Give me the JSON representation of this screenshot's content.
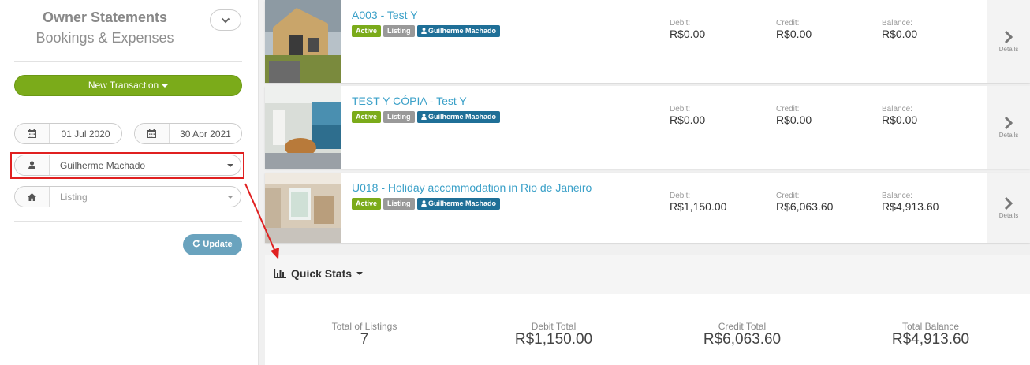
{
  "sidebar": {
    "title": "Owner Statements",
    "subtitle": "Bookings & Expenses",
    "new_transaction": "New Transaction",
    "date_from": "01 Jul 2020",
    "date_to": "30 Apr 2021",
    "owner": "Guilherme Machado",
    "listing_placeholder": "Listing",
    "update": "Update"
  },
  "labels": {
    "debit": "Debit:",
    "credit": "Credit:",
    "balance": "Balance:",
    "details": "Details",
    "active": "Active",
    "listing": "Listing"
  },
  "rows": [
    {
      "title": "A003 - Test Y",
      "owner": "Guilherme Machado",
      "debit": "R$0.00",
      "credit": "R$0.00",
      "balance": "R$0.00"
    },
    {
      "title": "TEST Y CÓPIA - Test Y",
      "owner": "Guilherme Machado",
      "debit": "R$0.00",
      "credit": "R$0.00",
      "balance": "R$0.00"
    },
    {
      "title": "U018 - Holiday accommodation in Rio de Janeiro",
      "owner": "Guilherme Machado",
      "debit": "R$1,150.00",
      "credit": "R$6,063.60",
      "balance": "R$4,913.60"
    }
  ],
  "quick_stats": {
    "title": "Quick Stats",
    "total_listings_label": "Total of Listings",
    "total_listings": "7",
    "debit_total_label": "Debit Total",
    "debit_total": "R$1,150.00",
    "credit_total_label": "Credit Total",
    "credit_total": "R$6,063.60",
    "total_balance_label": "Total Balance",
    "total_balance": "R$4,913.60"
  },
  "colors": {
    "accent_green": "#7bab1a",
    "link_blue": "#3aa0c8",
    "annotation_red": "#e02020"
  }
}
